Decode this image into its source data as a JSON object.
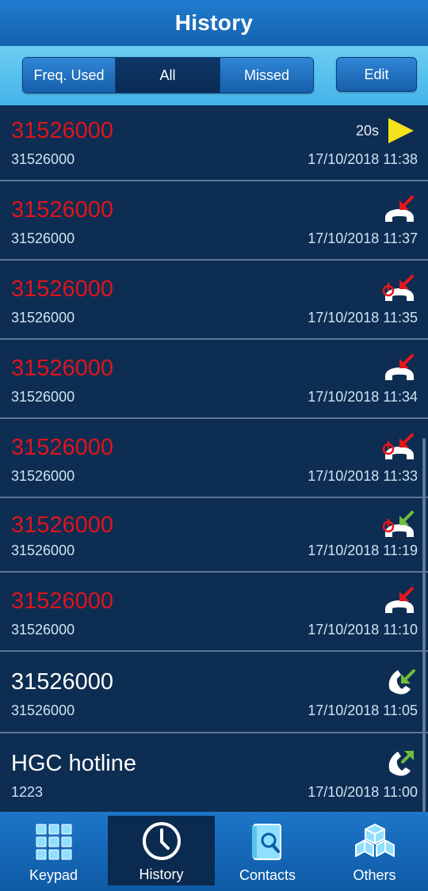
{
  "header": {
    "title": "History"
  },
  "filters": {
    "tabs": [
      {
        "label": "Freq. Used",
        "active": false
      },
      {
        "label": "All",
        "active": true
      },
      {
        "label": "Missed",
        "active": false
      }
    ],
    "edit_label": "Edit"
  },
  "calls": [
    {
      "name": "31526000",
      "number": "31526000",
      "time": "17/10/2018 11:38",
      "status": "missed",
      "icon": "voicemail-play-icon",
      "duration": "20s"
    },
    {
      "name": "31526000",
      "number": "31526000",
      "time": "17/10/2018 11:37",
      "status": "missed",
      "icon": "missed-call-icon"
    },
    {
      "name": "31526000",
      "number": "31526000",
      "time": "17/10/2018 11:35",
      "status": "missed",
      "icon": "rejected-missed-call-icon"
    },
    {
      "name": "31526000",
      "number": "31526000",
      "time": "17/10/2018 11:34",
      "status": "missed",
      "icon": "missed-call-icon"
    },
    {
      "name": "31526000",
      "number": "31526000",
      "time": "17/10/2018 11:33",
      "status": "missed",
      "icon": "rejected-missed-call-icon"
    },
    {
      "name": "31526000",
      "number": "31526000",
      "time": "17/10/2018 11:19",
      "status": "missed",
      "icon": "rejected-incoming-call-icon"
    },
    {
      "name": "31526000",
      "number": "31526000",
      "time": "17/10/2018 11:10",
      "status": "missed",
      "icon": "missed-call-icon"
    },
    {
      "name": "31526000",
      "number": "31526000",
      "time": "17/10/2018 11:05",
      "status": "normal",
      "icon": "incoming-call-icon"
    },
    {
      "name": "HGC hotline",
      "number": "1223",
      "time": "17/10/2018 11:00",
      "status": "normal",
      "icon": "outgoing-call-icon"
    }
  ],
  "tabbar": {
    "items": [
      {
        "label": "Keypad",
        "icon": "keypad-icon",
        "active": false
      },
      {
        "label": "History",
        "icon": "clock-icon",
        "active": true
      },
      {
        "label": "Contacts",
        "icon": "contacts-book-icon",
        "active": false
      },
      {
        "label": "Others",
        "icon": "cubes-icon",
        "active": false
      }
    ]
  },
  "colors": {
    "missed": "#e0141c",
    "normal": "#ffffff",
    "play": "#f5e21b",
    "missed_arrow": "#e8151b",
    "incoming_arrow": "#6dbf3b"
  }
}
